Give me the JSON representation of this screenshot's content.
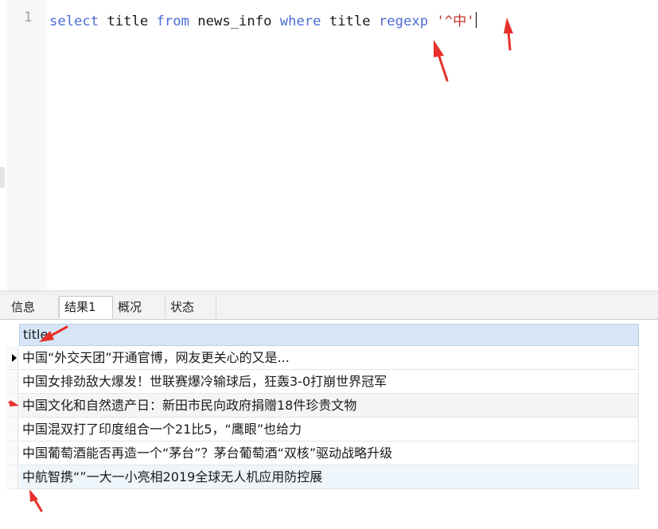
{
  "editor": {
    "line_number": "1",
    "tokens": {
      "select": "select",
      "title1": " title ",
      "from": "from",
      "table": " news_info ",
      "where": "where",
      "title2": " title ",
      "regexp": "regexp",
      "space": " ",
      "pattern": "'^中'"
    }
  },
  "tabs": [
    {
      "label": "信息",
      "active": false
    },
    {
      "label": "结果1",
      "active": true
    },
    {
      "label": "概况",
      "active": false
    },
    {
      "label": "状态",
      "active": false
    }
  ],
  "grid": {
    "columns": [
      "title"
    ],
    "rows": [
      "中国“外交天团”开通官博，网友更关心的又是...",
      "中国女排劲敌大爆发！世联赛爆冷输球后，狂轰3-0打崩世界冠军",
      "中国文化和自然遗产日：新田市民向政府捐赠18件珍贵文物",
      "中国混双打了印度组合一个21比5，“鹰眼”也给力",
      "中国葡萄酒能否再造一个“茅台”？茅台葡萄酒“双核”驱动战略升级",
      "中航智携“”一大一小亮相2019全球无人机应用防控展"
    ],
    "current_row": 0
  },
  "colors": {
    "keyword": "#4b6cd6",
    "string": "#c4322c",
    "annotation_arrow": "#e8302a",
    "header_bg": "#d6e6f7"
  }
}
